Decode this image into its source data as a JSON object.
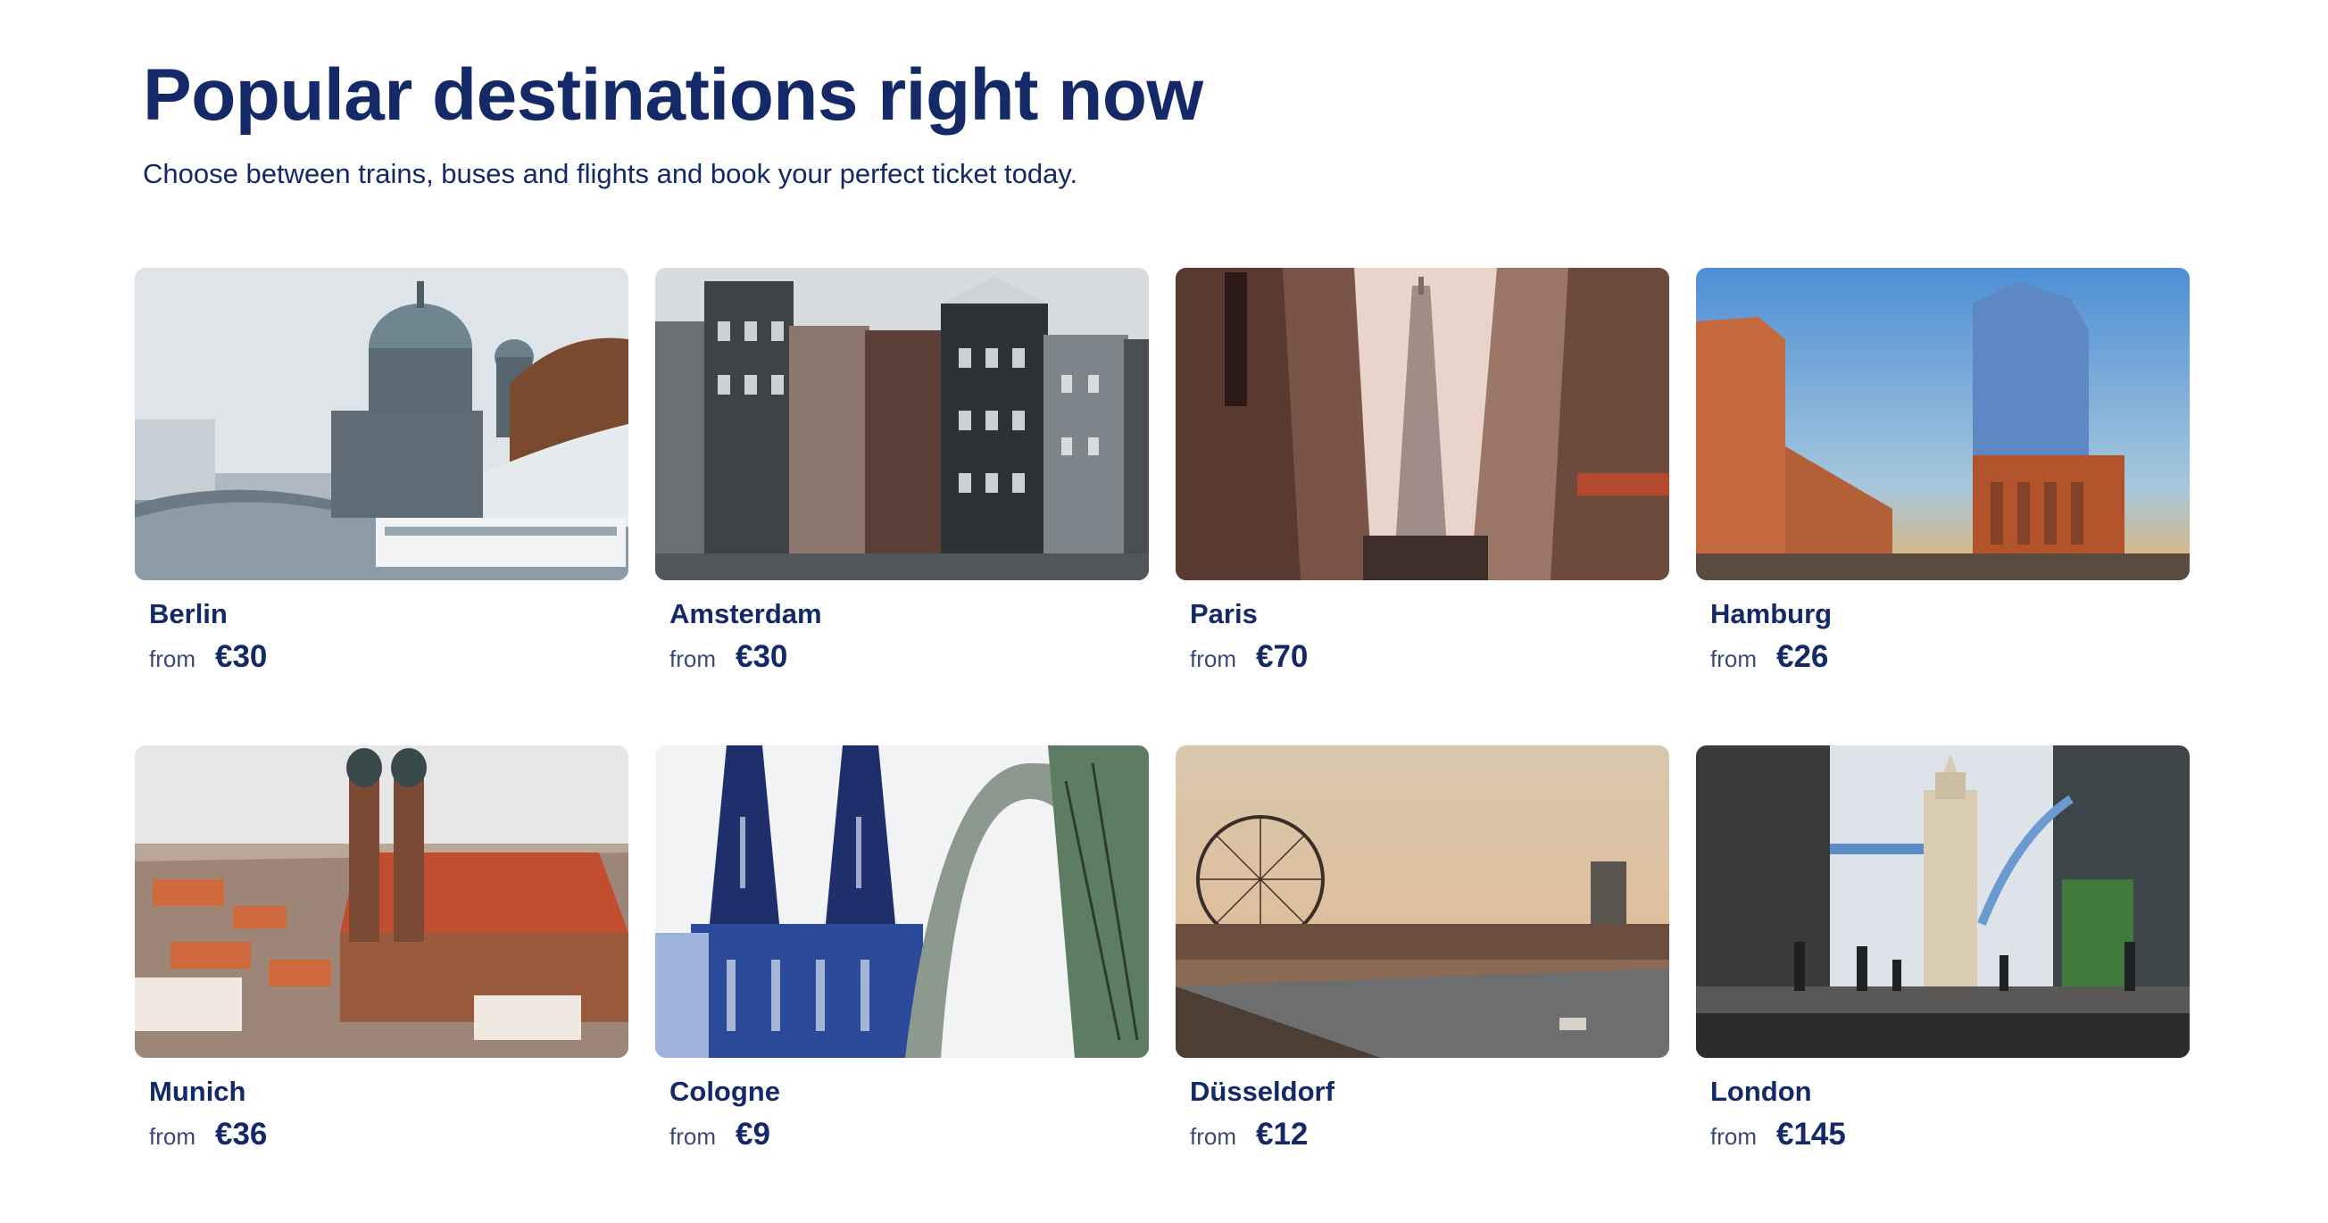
{
  "header": {
    "title": "Popular destinations right now",
    "subtitle": "Choose between trains, buses and flights and book your perfect ticket today."
  },
  "destinations": [
    {
      "name": "Berlin",
      "from_label": "from",
      "price": "€30"
    },
    {
      "name": "Amsterdam",
      "from_label": "from",
      "price": "€30"
    },
    {
      "name": "Paris",
      "from_label": "from",
      "price": "€70"
    },
    {
      "name": "Hamburg",
      "from_label": "from",
      "price": "€26"
    },
    {
      "name": "Munich",
      "from_label": "from",
      "price": "€36"
    },
    {
      "name": "Cologne",
      "from_label": "from",
      "price": "€9"
    },
    {
      "name": "Düsseldorf",
      "from_label": "from",
      "price": "€12"
    },
    {
      "name": "London",
      "from_label": "from",
      "price": "€145"
    }
  ],
  "colors": {
    "brand_navy": "#132968",
    "muted_text": "#3a4a78",
    "background": "#ffffff"
  }
}
